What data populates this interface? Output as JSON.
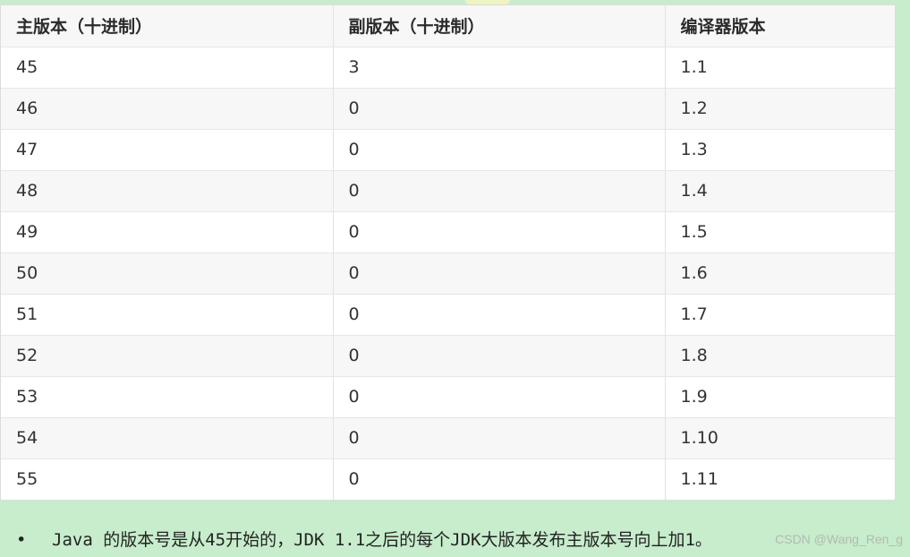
{
  "table": {
    "headers": [
      "主版本（十进制）",
      "副版本（十进制）",
      "编译器版本"
    ],
    "rows": [
      [
        "45",
        "3",
        "1.1"
      ],
      [
        "46",
        "0",
        "1.2"
      ],
      [
        "47",
        "0",
        "1.3"
      ],
      [
        "48",
        "0",
        "1.4"
      ],
      [
        "49",
        "0",
        "1.5"
      ],
      [
        "50",
        "0",
        "1.6"
      ],
      [
        "51",
        "0",
        "1.7"
      ],
      [
        "52",
        "0",
        "1.8"
      ],
      [
        "53",
        "0",
        "1.9"
      ],
      [
        "54",
        "0",
        "1.10"
      ],
      [
        "55",
        "0",
        "1.11"
      ]
    ]
  },
  "note": {
    "bullet": "•",
    "text": "Java 的版本号是从45开始的，JDK 1.1之后的每个JDK大版本发布主版本号向上加1。"
  },
  "watermark": "CSDN @Wang_Ren_g",
  "colors": {
    "page_background": "#c7edcc",
    "header_background": "#f7f7f7",
    "row_alt_background": "#f7f7f7"
  }
}
